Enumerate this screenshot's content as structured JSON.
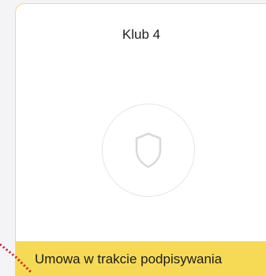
{
  "card": {
    "club_name": "Klub 4",
    "status": "Umowa w trakcie podpisywania",
    "crest_icon": "shield-icon"
  },
  "colors": {
    "status_bar": "#f6da55",
    "card_border": "#f2dc7a",
    "indicator": "#d4181b"
  }
}
